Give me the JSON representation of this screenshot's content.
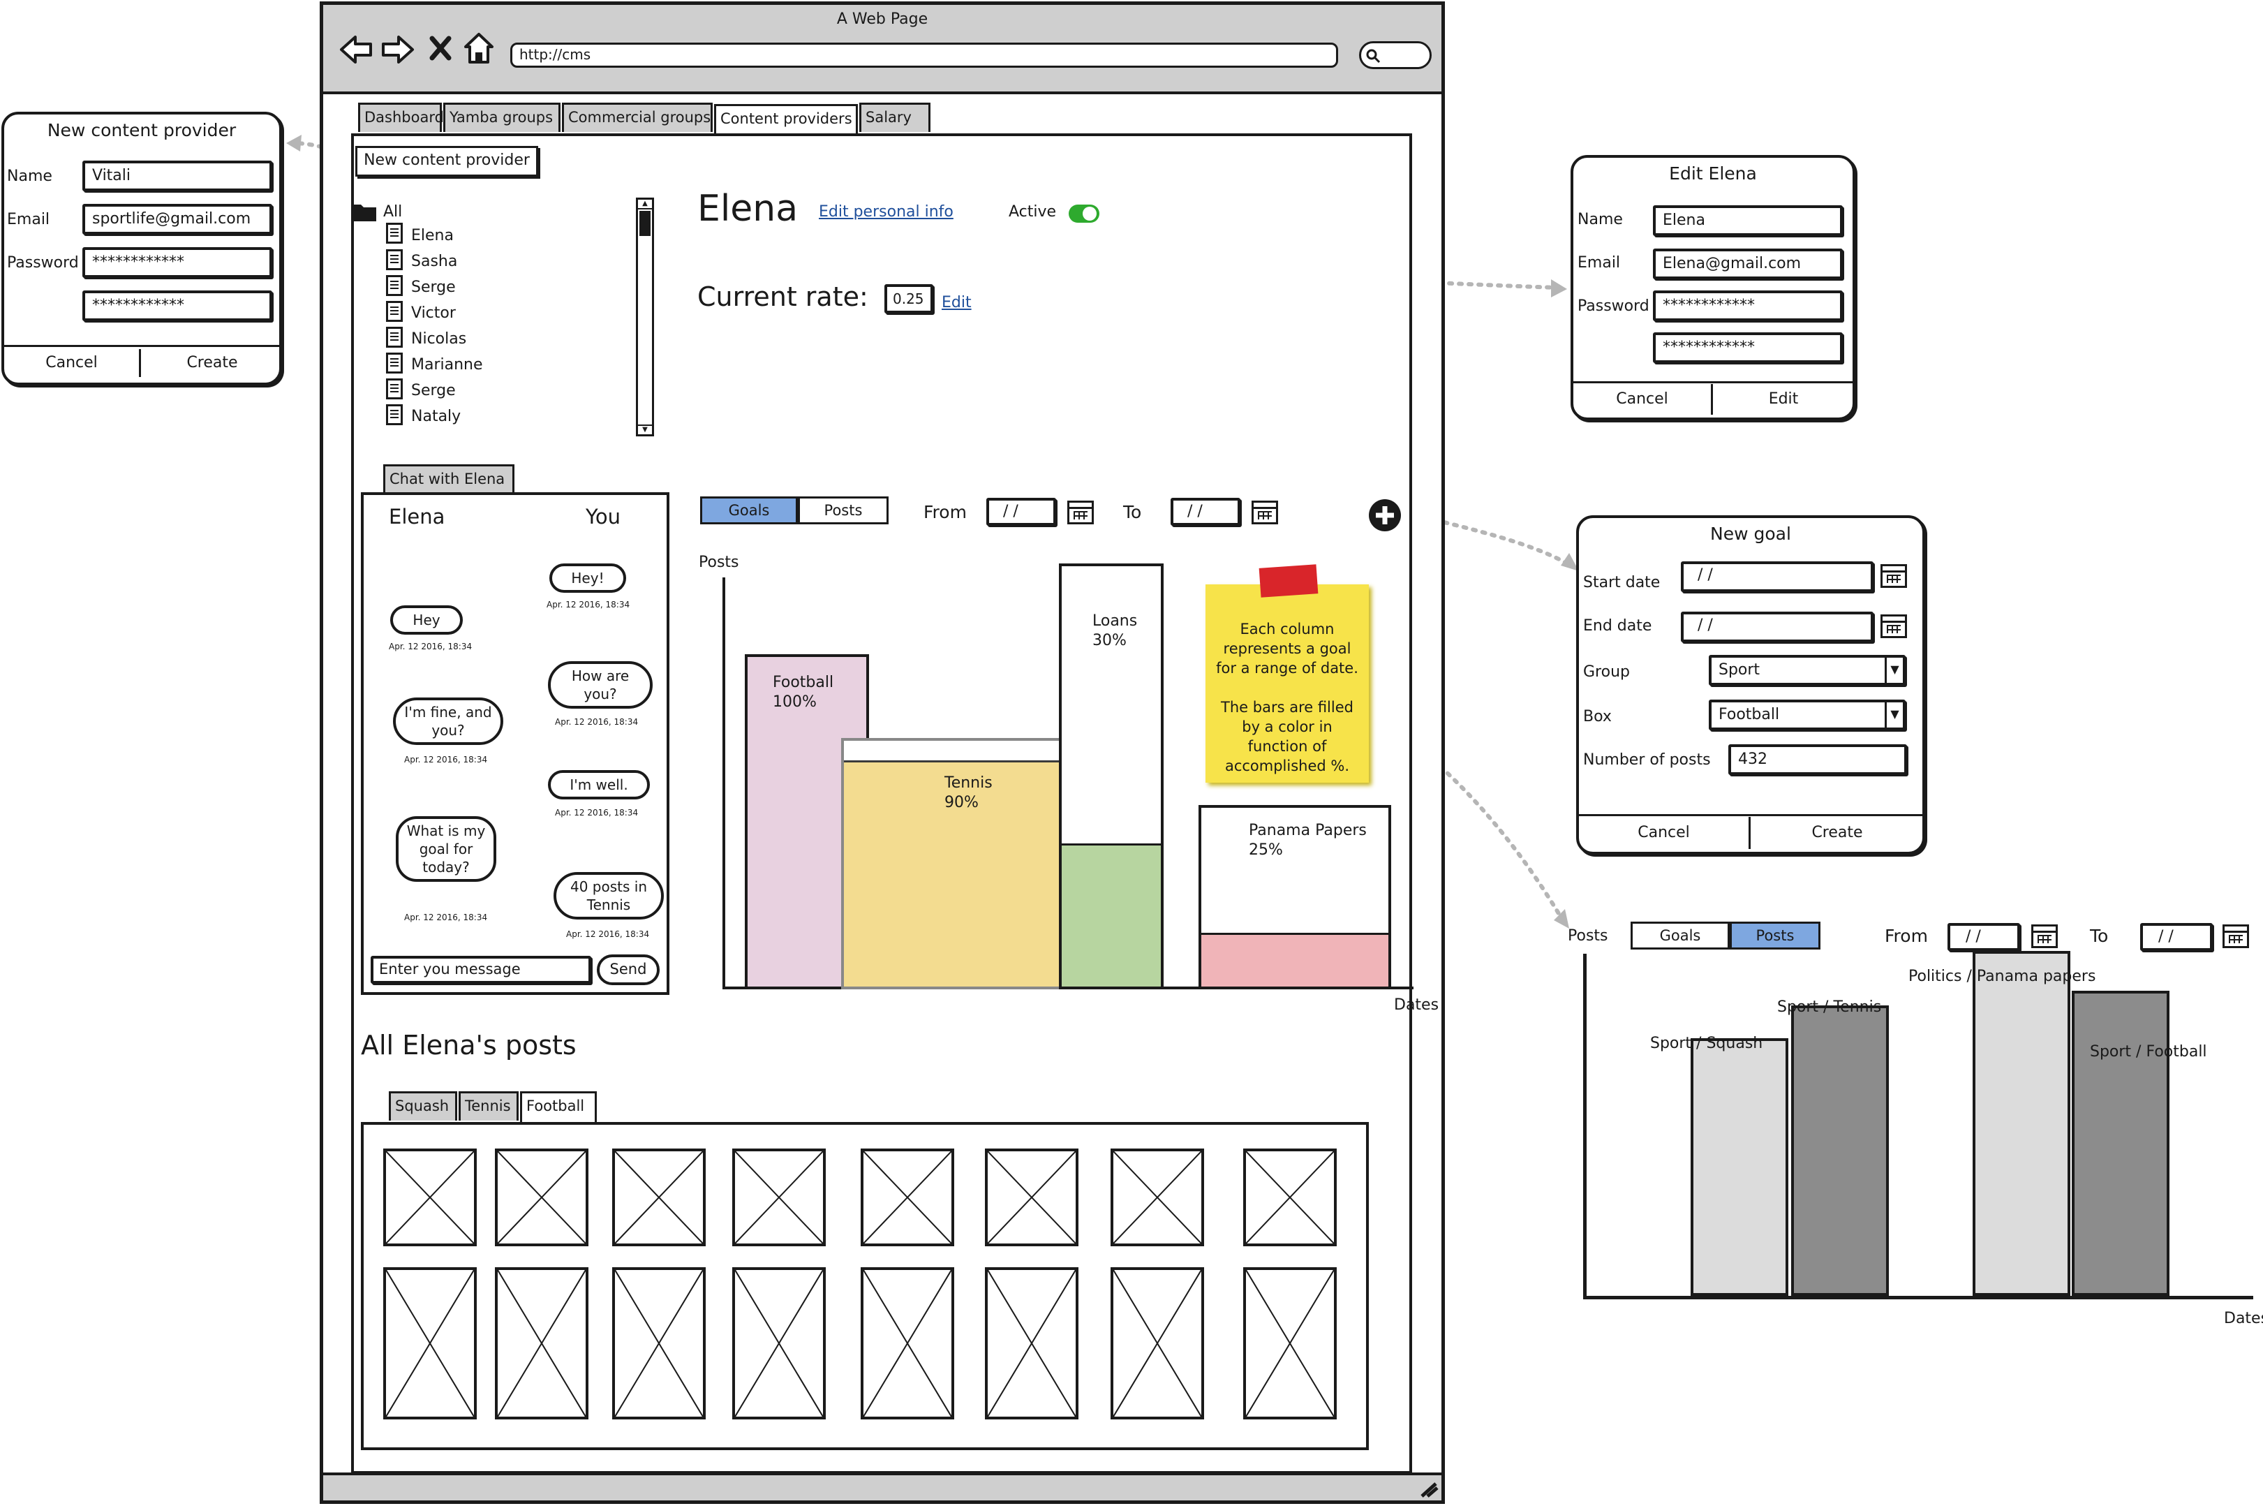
{
  "browser": {
    "title": "A Web Page",
    "url": "http://cms"
  },
  "tabs": [
    "Dashboard",
    "Yamba groups",
    "Commercial groups",
    "Content providers",
    "Salary"
  ],
  "new_provider_button": "New content provider",
  "tree": {
    "root": "All",
    "items": [
      "Elena",
      "Sasha",
      "Serge",
      "Victor",
      "Nicolas",
      "Marianne",
      "Serge",
      "Nataly"
    ]
  },
  "profile": {
    "name": "Elena",
    "edit_info_link": "Edit personal info",
    "active_label": "Active",
    "rate_label": "Current rate:",
    "rate_value": "0.25",
    "rate_edit_link": "Edit"
  },
  "chat": {
    "tab_label": "Chat with Elena",
    "left_header": "Elena",
    "right_header": "You",
    "messages": [
      {
        "side": "you",
        "text": "Hey!",
        "time": "Apr. 12 2016, 18:34"
      },
      {
        "side": "elena",
        "text": "Hey",
        "time": "Apr. 12 2016, 18:34"
      },
      {
        "side": "you",
        "text": "How are you?",
        "time": "Apr. 12 2016, 18:34"
      },
      {
        "side": "elena",
        "text": "I'm fine, and you?",
        "time": "Apr. 12 2016, 18:34"
      },
      {
        "side": "you",
        "text": "I'm well.",
        "time": "Apr. 12 2016, 18:34"
      },
      {
        "side": "elena",
        "text": "What is my goal for today?",
        "time": "Apr. 12 2016, 18:34"
      },
      {
        "side": "you",
        "text": "40 posts in Tennis",
        "time": "Apr. 12 2016, 18:34"
      }
    ],
    "input_placeholder": "Enter you message",
    "send_label": "Send"
  },
  "goals_chart": {
    "toggle": [
      "Goals",
      "Posts"
    ],
    "selected": "Goals",
    "from_label": "From",
    "to_label": "To",
    "date_placeholder": "/ /",
    "y_label": "Posts",
    "x_label": "Dates",
    "note": "Each column represents a goal for a range of date.\n\nThe bars are filled by a color in function of accomplished %."
  },
  "chart_data": [
    {
      "type": "bar",
      "title": "",
      "xlabel": "Dates",
      "ylabel": "Posts",
      "series": [
        {
          "name": "Football",
          "label": "100%",
          "accomplished": 1.0,
          "color": "#e8d1e0"
        },
        {
          "name": "Tennis",
          "label": "90%",
          "accomplished": 0.9,
          "color": "#f5e09a"
        },
        {
          "name": "Loans",
          "label": "30%",
          "accomplished": 0.3,
          "color": "#b7d5a0"
        },
        {
          "name": "Panama Papers",
          "label": "25%",
          "accomplished": 0.25,
          "color": "#f0b4b8"
        }
      ]
    },
    {
      "type": "bar",
      "title": "",
      "xlabel": "Dates",
      "ylabel": "Posts",
      "categories": [
        "Sport / Squash",
        "Sport / Tennis",
        "Politics / Panama papers",
        "Sport / Football"
      ],
      "values": [
        0.71,
        0.8,
        0.95,
        0.84
      ],
      "colors": [
        "#dcdcdc",
        "#8c8c8c",
        "#dcdcdc",
        "#8c8c8c"
      ]
    }
  ],
  "posts_section": {
    "title": "All Elena's posts",
    "tabs": [
      "Squash",
      "Tennis",
      "Football"
    ],
    "active_tab": "Football"
  },
  "new_provider_dialog": {
    "title": "New content provider",
    "name_label": "Name",
    "name_value": "Vitali",
    "email_label": "Email",
    "email_value": "sportlife@gmail.com",
    "password_label": "Password",
    "password_value": "************",
    "confirm_value": "************",
    "cancel": "Cancel",
    "create": "Create"
  },
  "edit_dialog": {
    "title": "Edit Elena",
    "name_label": "Name",
    "name_value": "Elena",
    "email_label": "Email",
    "email_value": "Elena@gmail.com",
    "password_label": "Password",
    "password_value": "************",
    "confirm_value": "************",
    "cancel": "Cancel",
    "edit": "Edit"
  },
  "new_goal_dialog": {
    "title": "New goal",
    "start_label": "Start date",
    "end_label": "End date",
    "date_placeholder": "/ /",
    "group_label": "Group",
    "group_value": "Sport",
    "box_label": "Box",
    "box_value": "Football",
    "posts_label": "Number of posts",
    "posts_value": "432",
    "cancel": "Cancel",
    "create": "Create"
  },
  "posts_chart": {
    "y_label": "Posts",
    "x_label": "Dates",
    "toggle": [
      "Goals",
      "Posts"
    ],
    "selected": "Posts",
    "from_label": "From",
    "to_label": "To",
    "date_placeholder": "/ /"
  }
}
